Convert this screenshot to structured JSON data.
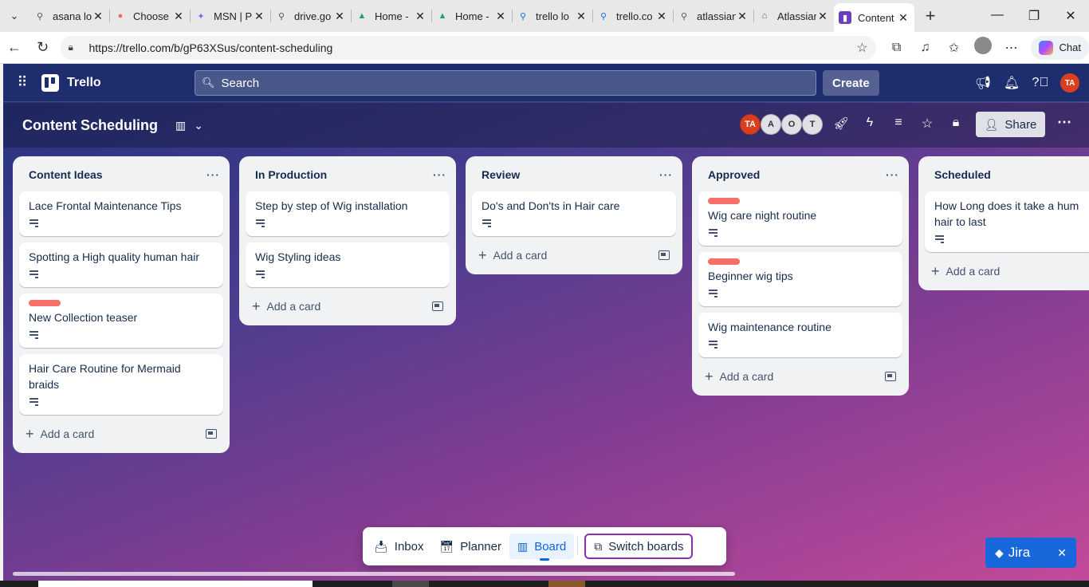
{
  "browser": {
    "tabs": [
      {
        "title": "asana lo",
        "icon": "search-icon"
      },
      {
        "title": "Choose",
        "icon": "asana-icon"
      },
      {
        "title": "MSN | P",
        "icon": "msn-icon"
      },
      {
        "title": "drive.go",
        "icon": "search-icon"
      },
      {
        "title": "Home -",
        "icon": "drive-icon"
      },
      {
        "title": "Home -",
        "icon": "drive-icon"
      },
      {
        "title": "trello lo",
        "icon": "search-icon"
      },
      {
        "title": "trello.co",
        "icon": "search-icon"
      },
      {
        "title": "atlassian",
        "icon": "search-icon"
      },
      {
        "title": "Atlassian",
        "icon": "atlassian-icon"
      },
      {
        "title": "Content",
        "icon": "trello-icon"
      }
    ],
    "url": "https://trello.com/b/gP63XSus/content-scheduling",
    "chat_label": "Chat"
  },
  "nav": {
    "logo": "Trello",
    "search_placeholder": "Search",
    "create_label": "Create",
    "user_initials": "TA"
  },
  "board": {
    "title": "Content Scheduling",
    "members": [
      "TA",
      "A",
      "O",
      "T"
    ],
    "share_label": "Share"
  },
  "lists": [
    {
      "title": "Content Ideas",
      "cards": [
        {
          "title": "Lace Frontal Maintenance Tips",
          "label": false
        },
        {
          "title": "Spotting a High quality human hair",
          "label": false
        },
        {
          "title": "New Collection teaser",
          "label": true
        },
        {
          "title": "Hair Care Routine for Mermaid braids",
          "label": false
        }
      ],
      "add_label": "Add a card"
    },
    {
      "title": "In Production",
      "cards": [
        {
          "title": "Step by step of Wig installation",
          "label": false
        },
        {
          "title": "Wig Styling ideas",
          "label": false
        }
      ],
      "add_label": "Add a card"
    },
    {
      "title": "Review",
      "cards": [
        {
          "title": "Do's and Don'ts in Hair care",
          "label": false
        }
      ],
      "add_label": "Add a card"
    },
    {
      "title": "Approved",
      "cards": [
        {
          "title": "Wig care night routine",
          "label": true
        },
        {
          "title": "Beginner wig tips",
          "label": true
        },
        {
          "title": "Wig maintenance routine",
          "label": false
        }
      ],
      "add_label": "Add a card"
    },
    {
      "title": "Scheduled",
      "cards": [
        {
          "title": "How Long does it take a hum hair to last",
          "label": false
        }
      ],
      "add_label": "Add a card"
    }
  ],
  "switcher": {
    "inbox": "Inbox",
    "planner": "Planner",
    "board": "Board",
    "switch": "Switch boards"
  },
  "jira": {
    "label": "Jira"
  },
  "colors": {
    "label_red": "#f87168",
    "accent_blue": "#0c66e4"
  }
}
